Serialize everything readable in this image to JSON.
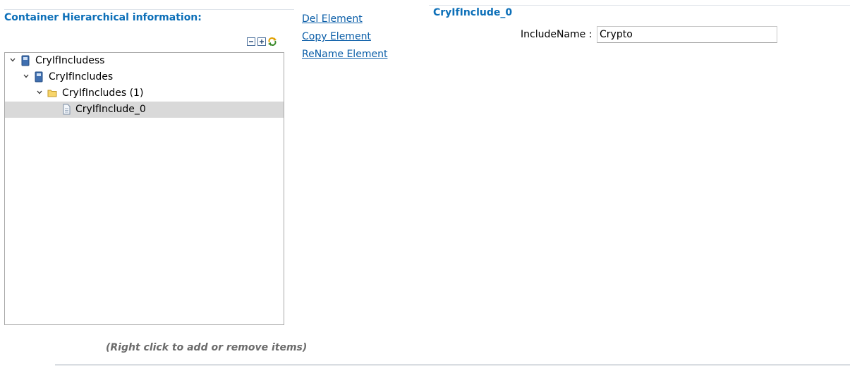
{
  "left_panel": {
    "title": "Container Hierarchical information:",
    "toolbar": [
      "collapse-all-icon",
      "expand-all-icon",
      "refresh-icon"
    ],
    "tree": [
      {
        "label": "CryIfIncludess",
        "icon": "module-icon",
        "depth": 0,
        "expanded": true,
        "selected": false
      },
      {
        "label": "CryIfIncludes",
        "icon": "module-icon",
        "depth": 1,
        "expanded": true,
        "selected": false
      },
      {
        "label": "CryIfIncludes (1)",
        "icon": "folder-icon",
        "depth": 2,
        "expanded": true,
        "selected": false
      },
      {
        "label": "CryIfInclude_0",
        "icon": "document-icon",
        "depth": 3,
        "expanded": false,
        "selected": true
      }
    ],
    "hint": "(Right click to add or remove items)"
  },
  "actions": {
    "del": "Del Element",
    "copy": "Copy Element",
    "rename": "ReName Element"
  },
  "right_panel": {
    "title": "CryIfInclude_0",
    "field_label": "IncludeName :",
    "field_value": "Crypto"
  },
  "colors": {
    "title": "#0c6fb8",
    "link": "#0b5ea8",
    "selection": "#d9d9d9"
  }
}
